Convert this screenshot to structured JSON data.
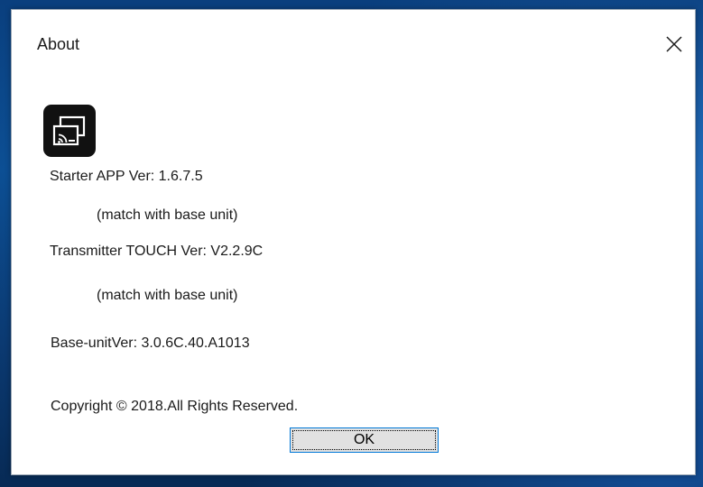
{
  "window": {
    "title": "About",
    "close_icon": "close-icon"
  },
  "app_icon": "screen-cast-icon",
  "info": {
    "starter_app_version": "Starter APP Ver: 1.6.7.5",
    "starter_match_note": "(match with base unit)",
    "transmitter_version": "Transmitter TOUCH Ver: V2.2.9C",
    "transmitter_match_note": "(match with base unit)",
    "base_unit_version": "Base-unitVer: 3.0.6C.40.A1013",
    "copyright": "Copyright © 2018.All Rights Reserved."
  },
  "buttons": {
    "ok_label": "OK"
  },
  "colors": {
    "desktop_background": "#0c4f94",
    "dialog_background": "#ffffff",
    "button_background": "#e1e1e1",
    "focus_border": "#0078d7"
  }
}
